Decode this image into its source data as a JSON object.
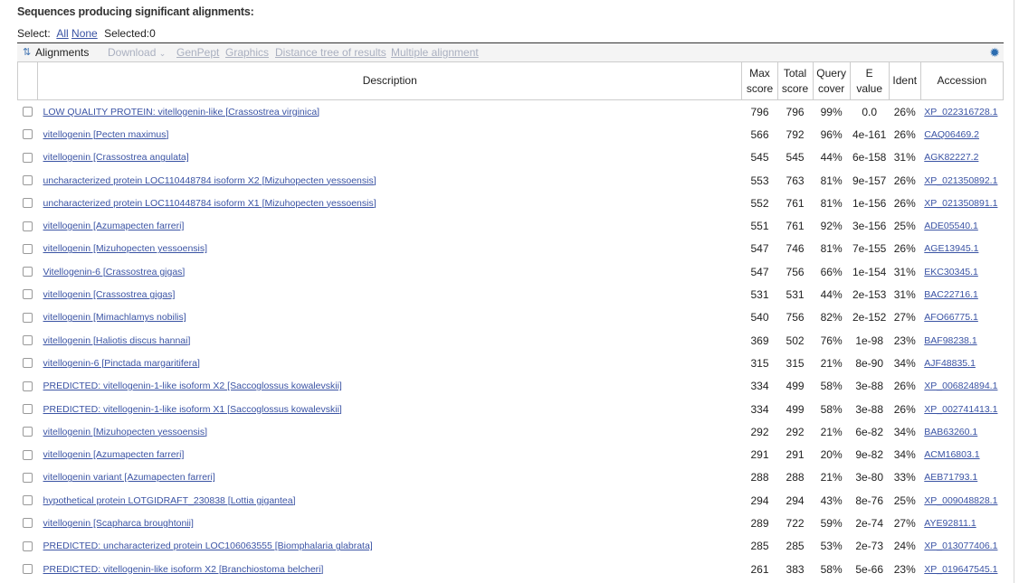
{
  "header": {
    "title": "Sequences producing significant alignments:",
    "select_label": "Select:",
    "select_all": "All",
    "select_none": "None",
    "selected": "Selected:0"
  },
  "toolbar": {
    "alignments": "Alignments",
    "download": "Download",
    "genpept": "GenPept",
    "graphics": "Graphics",
    "distance_tree": "Distance tree of results",
    "multiple_alignment": "Multiple alignment"
  },
  "columns": {
    "description": "Description",
    "max_score_1": "Max",
    "max_score_2": "score",
    "total_score_1": "Total",
    "total_score_2": "score",
    "query_cover_1": "Query",
    "query_cover_2": "cover",
    "evalue_1": "E",
    "evalue_2": "value",
    "ident": "Ident",
    "accession": "Accession"
  },
  "rows": [
    {
      "description": "LOW QUALITY PROTEIN: vitellogenin-like [Crassostrea virginica]",
      "max": "796",
      "total": "796",
      "cover": "99%",
      "evalue": "0.0",
      "ident": "26%",
      "accession": "XP_022316728.1"
    },
    {
      "description": "vitellogenin [Pecten maximus]",
      "max": "566",
      "total": "792",
      "cover": "96%",
      "evalue": "4e-161",
      "ident": "26%",
      "accession": "CAQ06469.2"
    },
    {
      "description": "vitellogenin [Crassostrea angulata]",
      "max": "545",
      "total": "545",
      "cover": "44%",
      "evalue": "6e-158",
      "ident": "31%",
      "accession": "AGK82227.2"
    },
    {
      "description": "uncharacterized protein LOC110448784 isoform X2 [Mizuhopecten yessoensis]",
      "max": "553",
      "total": "763",
      "cover": "81%",
      "evalue": "9e-157",
      "ident": "26%",
      "accession": "XP_021350892.1"
    },
    {
      "description": "uncharacterized protein LOC110448784 isoform X1 [Mizuhopecten yessoensis]",
      "max": "552",
      "total": "761",
      "cover": "81%",
      "evalue": "1e-156",
      "ident": "26%",
      "accession": "XP_021350891.1"
    },
    {
      "description": "vitellogenin [Azumapecten farreri]",
      "max": "551",
      "total": "761",
      "cover": "92%",
      "evalue": "3e-156",
      "ident": "25%",
      "accession": "ADE05540.1"
    },
    {
      "description": "vitellogenin [Mizuhopecten yessoensis]",
      "max": "547",
      "total": "746",
      "cover": "81%",
      "evalue": "7e-155",
      "ident": "26%",
      "accession": "AGE13945.1"
    },
    {
      "description": "Vitellogenin-6 [Crassostrea gigas]",
      "max": "547",
      "total": "756",
      "cover": "66%",
      "evalue": "1e-154",
      "ident": "31%",
      "accession": "EKC30345.1"
    },
    {
      "description": "vitellogenin [Crassostrea gigas]",
      "max": "531",
      "total": "531",
      "cover": "44%",
      "evalue": "2e-153",
      "ident": "31%",
      "accession": "BAC22716.1"
    },
    {
      "description": "vitellogenin [Mimachlamys nobilis]",
      "max": "540",
      "total": "756",
      "cover": "82%",
      "evalue": "2e-152",
      "ident": "27%",
      "accession": "AFO66775.1"
    },
    {
      "description": "vitellogenin [Haliotis discus hannai]",
      "max": "369",
      "total": "502",
      "cover": "76%",
      "evalue": "1e-98",
      "ident": "23%",
      "accession": "BAF98238.1"
    },
    {
      "description": "vitellogenin-6 [Pinctada margaritifera]",
      "max": "315",
      "total": "315",
      "cover": "21%",
      "evalue": "8e-90",
      "ident": "34%",
      "accession": "AJF48835.1"
    },
    {
      "description": "PREDICTED: vitellogenin-1-like isoform X2 [Saccoglossus kowalevskii]",
      "max": "334",
      "total": "499",
      "cover": "58%",
      "evalue": "3e-88",
      "ident": "26%",
      "accession": "XP_006824894.1"
    },
    {
      "description": "PREDICTED: vitellogenin-1-like isoform X1 [Saccoglossus kowalevskii]",
      "max": "334",
      "total": "499",
      "cover": "58%",
      "evalue": "3e-88",
      "ident": "26%",
      "accession": "XP_002741413.1"
    },
    {
      "description": "vitellogenin [Mizuhopecten yessoensis]",
      "max": "292",
      "total": "292",
      "cover": "21%",
      "evalue": "6e-82",
      "ident": "34%",
      "accession": "BAB63260.1"
    },
    {
      "description": "vitellogenin [Azumapecten farreri]",
      "max": "291",
      "total": "291",
      "cover": "20%",
      "evalue": "9e-82",
      "ident": "34%",
      "accession": "ACM16803.1"
    },
    {
      "description": "vitellogenin variant [Azumapecten farreri]",
      "max": "288",
      "total": "288",
      "cover": "21%",
      "evalue": "3e-80",
      "ident": "33%",
      "accession": "AEB71793.1"
    },
    {
      "description": "hypothetical protein LOTGIDRAFT_230838 [Lottia gigantea]",
      "max": "294",
      "total": "294",
      "cover": "43%",
      "evalue": "8e-76",
      "ident": "25%",
      "accession": "XP_009048828.1"
    },
    {
      "description": "vitellogenin [Scapharca broughtonii]",
      "max": "289",
      "total": "722",
      "cover": "59%",
      "evalue": "2e-74",
      "ident": "27%",
      "accession": "AYE92811.1"
    },
    {
      "description": "PREDICTED: uncharacterized protein LOC106063555 [Biomphalaria glabrata]",
      "max": "285",
      "total": "285",
      "cover": "53%",
      "evalue": "2e-73",
      "ident": "24%",
      "accession": "XP_013077406.1"
    },
    {
      "description": "PREDICTED: vitellogenin-like isoform X2 [Branchiostoma belcheri]",
      "max": "261",
      "total": "383",
      "cover": "58%",
      "evalue": "5e-66",
      "ident": "23%",
      "accession": "XP_019647545.1"
    }
  ]
}
